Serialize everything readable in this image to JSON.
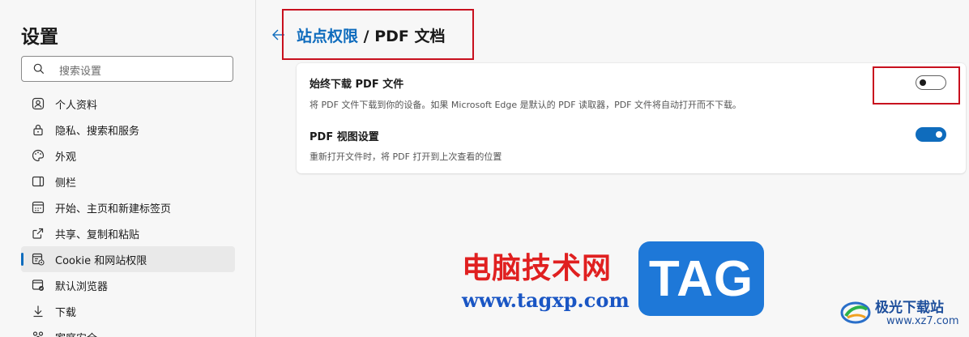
{
  "sidebar": {
    "title": "设置",
    "search_placeholder": "搜索设置",
    "items": [
      {
        "label": "个人资料",
        "icon": "profile-icon"
      },
      {
        "label": "隐私、搜索和服务",
        "icon": "lock-icon"
      },
      {
        "label": "外观",
        "icon": "palette-icon"
      },
      {
        "label": "侧栏",
        "icon": "sidebar-icon"
      },
      {
        "label": "开始、主页和新建标签页",
        "icon": "home-grid-icon"
      },
      {
        "label": "共享、复制和粘贴",
        "icon": "share-icon"
      },
      {
        "label": "Cookie 和网站权限",
        "icon": "site-permissions-icon",
        "active": true
      },
      {
        "label": "默认浏览器",
        "icon": "browser-icon"
      },
      {
        "label": "下载",
        "icon": "download-icon"
      },
      {
        "label": "家庭安全",
        "icon": "family-icon"
      }
    ]
  },
  "main": {
    "breadcrumb": {
      "parent": "站点权限",
      "separator": "/",
      "current": "PDF 文档"
    },
    "settings": [
      {
        "title": "始终下载 PDF 文件",
        "description": "将 PDF 文件下载到你的设备。如果 Microsoft Edge 是默认的 PDF 读取器，PDF 文件将自动打开而不下载。",
        "enabled": false
      },
      {
        "title": "PDF 视图设置",
        "description": "重新打开文件时，将 PDF 打开到上次查看的位置",
        "enabled": true
      }
    ]
  },
  "watermark": {
    "site_name": "电脑技术网",
    "site_url": "www.tagxp.com",
    "badge": "TAG",
    "logo_name": "极光下载站",
    "logo_url": "www.xz7.com"
  },
  "colors": {
    "accent": "#0f6cbd",
    "highlight": "#c8101e"
  }
}
